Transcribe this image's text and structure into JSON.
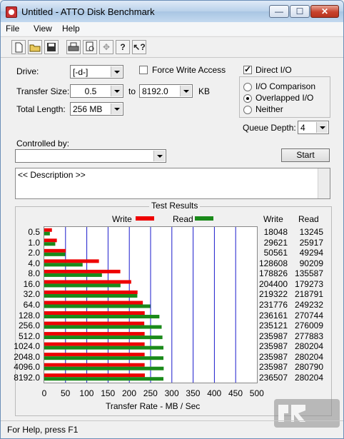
{
  "window": {
    "title": "Untitled - ATTO Disk Benchmark",
    "minimize": "—",
    "maximize": "☐",
    "close": "✕"
  },
  "menu": [
    "File",
    "View",
    "Help"
  ],
  "toolbar": [
    "new-icon",
    "open-icon",
    "save-icon",
    "print-icon",
    "print-preview-icon",
    "move-icon",
    "help-icon",
    "context-help-icon"
  ],
  "settings": {
    "drive_label": "Drive:",
    "drive_value": "[-d-]",
    "force_write_label": "Force Write Access",
    "force_write_checked": false,
    "direct_io_label": "Direct I/O",
    "direct_io_checked": true,
    "transfer_size_label": "Transfer Size:",
    "transfer_from": "0.5",
    "to_label": "to",
    "transfer_to": "8192.0",
    "kb_label": "KB",
    "total_length_label": "Total Length:",
    "total_length_value": "256 MB",
    "io_comparison_label": "I/O Comparison",
    "overlapped_io_label": "Overlapped I/O",
    "neither_label": "Neither",
    "selected_io_mode": "Overlapped I/O",
    "queue_depth_label": "Queue Depth:",
    "queue_depth_value": "4",
    "controlled_by_label": "Controlled by:",
    "controlled_by_value": "",
    "start_label": "Start",
    "description": "<< Description >>"
  },
  "results": {
    "title": "Test Results",
    "legend_write": "Write",
    "legend_read": "Read",
    "col_write": "Write",
    "col_read": "Read",
    "xlabel": "Transfer Rate - MB / Sec"
  },
  "colors": {
    "write": "#ee0000",
    "read": "#1a8a1a",
    "grid": "#1a1acc"
  },
  "chart_data": {
    "type": "bar",
    "orientation": "horizontal",
    "categories": [
      "0.5",
      "1.0",
      "2.0",
      "4.0",
      "8.0",
      "16.0",
      "32.0",
      "64.0",
      "128.0",
      "256.0",
      "512.0",
      "1024.0",
      "2048.0",
      "4096.0",
      "8192.0"
    ],
    "series": [
      {
        "name": "Write",
        "values": [
          18048,
          29621,
          50561,
          128608,
          178826,
          204400,
          219322,
          231776,
          236161,
          235121,
          235987,
          235987,
          235987,
          235987,
          236507
        ]
      },
      {
        "name": "Read",
        "values": [
          13245,
          25917,
          49294,
          90209,
          135587,
          179273,
          218791,
          249232,
          270744,
          276009,
          277883,
          280204,
          280204,
          280790,
          280204
        ]
      }
    ],
    "xticks": [
      "0",
      "50",
      "100",
      "150",
      "200",
      "250",
      "300",
      "350",
      "400",
      "450",
      "500"
    ],
    "xlim": [
      0,
      500
    ],
    "xlabel": "Transfer Rate - MB / Sec",
    "grid": true
  },
  "status": {
    "text": "For Help, press F1"
  },
  "watermark": "LEGIT REVIEWS"
}
